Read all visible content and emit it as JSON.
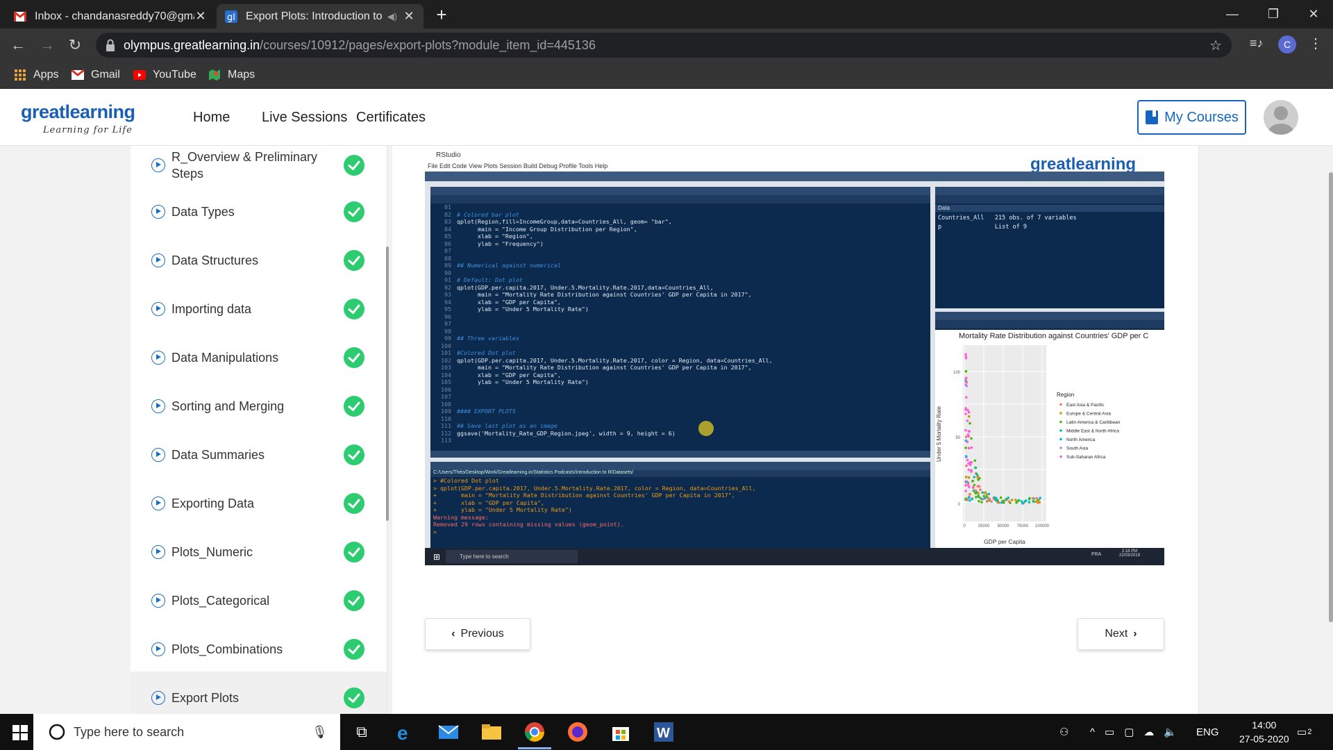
{
  "browser": {
    "tabs": [
      {
        "title": "Inbox - chandanasreddy70@gma",
        "icon": "gmail-icon"
      },
      {
        "title": "Export Plots: Introduction to",
        "icon": "greatlearning-icon",
        "active": true
      }
    ],
    "url_domain": "olympus.greatlearning.in",
    "url_path": "/courses/10912/pages/export-plots?module_item_id=445136",
    "profile_initial": "C",
    "bookmarks": [
      {
        "label": "Apps",
        "icon": "apps-grid-icon"
      },
      {
        "label": "Gmail",
        "icon": "gmail-icon"
      },
      {
        "label": "YouTube",
        "icon": "youtube-icon"
      },
      {
        "label": "Maps",
        "icon": "maps-icon"
      }
    ]
  },
  "site": {
    "logo": "greatlearning",
    "logo_tagline": "Learning for Life",
    "nav": [
      "Home",
      "Live Sessions",
      "Certificates"
    ],
    "my_courses": "My Courses"
  },
  "sidebar": {
    "modules": [
      {
        "label": "R_Overview & Preliminary Steps",
        "completed": true
      },
      {
        "label": "Data Types",
        "completed": true
      },
      {
        "label": "Data Structures",
        "completed": true
      },
      {
        "label": "Importing data",
        "completed": true
      },
      {
        "label": "Data Manipulations",
        "completed": true
      },
      {
        "label": "Sorting and Merging",
        "completed": true
      },
      {
        "label": "Data Summaries",
        "completed": true
      },
      {
        "label": "Exporting Data",
        "completed": true
      },
      {
        "label": "Plots_Numeric",
        "completed": true
      },
      {
        "label": "Plots_Categorical",
        "completed": true
      },
      {
        "label": "Plots_Combinations",
        "completed": true
      },
      {
        "label": "Export Plots",
        "completed": true,
        "active": true
      }
    ]
  },
  "video": {
    "window_title": "RStudio",
    "menu": "File   Edit   Code   View   Plots   Session   Build   Debug   Profile   Tools   Help",
    "watermark": "greatlearning",
    "code_lines": [
      {
        "n": "81",
        "t": ""
      },
      {
        "n": "82",
        "t": "# Colored bar plot",
        "cls": "c"
      },
      {
        "n": "83",
        "t": "qplot(Region,fill=IncomeGroup,data=Countries_All, geom= \"bar\","
      },
      {
        "n": "84",
        "t": "      main = \"Income Group Distribution per Region\","
      },
      {
        "n": "85",
        "t": "      xlab = \"Region\","
      },
      {
        "n": "86",
        "t": "      ylab = \"Frequency\")"
      },
      {
        "n": "87",
        "t": ""
      },
      {
        "n": "88",
        "t": ""
      },
      {
        "n": "89",
        "t": "## Numerical against numerical",
        "cls": "c"
      },
      {
        "n": "90",
        "t": ""
      },
      {
        "n": "91",
        "t": "# Default: Dot plot",
        "cls": "c"
      },
      {
        "n": "92",
        "t": "qplot(GDP.per.capita.2017, Under.5.Mortality.Rate.2017,data=Countries_All,"
      },
      {
        "n": "93",
        "t": "      main = \"Mortality Rate Distribution against Countries' GDP per Capita in 2017\","
      },
      {
        "n": "94",
        "t": "      xlab = \"GDP per Capita\","
      },
      {
        "n": "95",
        "t": "      ylab = \"Under 5 Mortality Rate\")"
      },
      {
        "n": "96",
        "t": ""
      },
      {
        "n": "97",
        "t": ""
      },
      {
        "n": "98",
        "t": ""
      },
      {
        "n": "99",
        "t": "## Three variables",
        "cls": "c"
      },
      {
        "n": "100",
        "t": ""
      },
      {
        "n": "101",
        "t": "#Colored Dot plot",
        "cls": "c"
      },
      {
        "n": "102",
        "t": "qplot(GDP.per.capita.2017, Under.5.Mortality.Rate.2017, color = Region, data=Countries_All,"
      },
      {
        "n": "103",
        "t": "      main = \"Mortality Rate Distribution against Countries' GDP per Capita in 2017\","
      },
      {
        "n": "104",
        "t": "      xlab = \"GDP per Capita\","
      },
      {
        "n": "105",
        "t": "      ylab = \"Under 5 Mortality Rate\")"
      },
      {
        "n": "106",
        "t": ""
      },
      {
        "n": "107",
        "t": ""
      },
      {
        "n": "108",
        "t": ""
      },
      {
        "n": "109",
        "t": "#### EXPORT PLOTS",
        "cls": "c"
      },
      {
        "n": "110",
        "t": ""
      },
      {
        "n": "111",
        "t": "## Save last plot as an image",
        "cls": "c"
      },
      {
        "n": "112",
        "t": "ggsave('Mortality_Rate_GDP_Region.jpeg', width = 9, height = 6)"
      },
      {
        "n": "113",
        "t": ""
      }
    ],
    "console_path": "C:/Users/Théo/Desktop/Work/Greatlearning.in/Statistics Podcasts/Introduction to R/Datasets/",
    "console_lines": [
      {
        "t": "> #Colored Dot plot"
      },
      {
        "t": "> qplot(GDP.per.capita.2017, Under.5.Mortality.Rate.2017, color = Region, data=Countries_All,"
      },
      {
        "t": "+       main = \"Mortality Rate Distribution against Countries' GDP per Capita in 2017\","
      },
      {
        "t": "+       xlab = \"GDP per Capita\","
      },
      {
        "t": "+       ylab = \"Under 5 Mortality Rate\")"
      },
      {
        "t": "Warning message:",
        "cls": "r"
      },
      {
        "t": "Removed 29 rows containing missing values (geom_point).",
        "cls": "r"
      },
      {
        "t": "> "
      }
    ],
    "env_header": "Data",
    "env_rows": [
      {
        "t": "Countries_All   215 obs. of 7 variables"
      },
      {
        "t": "p               List of 9"
      }
    ],
    "plot_title": "Mortality Rate Distribution against Countries' GDP per C",
    "plot_ylabel": "Under 5 Mortality Rate",
    "plot_xlabel": "GDP per Capita",
    "plot_yticks": [
      "100",
      "50",
      "0"
    ],
    "plot_xticks": [
      "0",
      "25000",
      "50000",
      "75000",
      "100000"
    ],
    "legend_title": "Region",
    "legend": [
      {
        "name": "East Asia & Pacific",
        "color": "#f8766d"
      },
      {
        "name": "Europe & Central Asia",
        "color": "#c49a00"
      },
      {
        "name": "Latin America & Caribbean",
        "color": "#53b400"
      },
      {
        "name": "Middle East & North Africa",
        "color": "#00c094"
      },
      {
        "name": "North America",
        "color": "#00b6eb"
      },
      {
        "name": "South Asia",
        "color": "#a58aff"
      },
      {
        "name": "Sub-Saharan Africa",
        "color": "#fb61d7"
      }
    ],
    "inner_search": "Type here to search",
    "inner_time": "2:18 PM",
    "inner_date": "22/03/2019",
    "inner_lang": "FRA"
  },
  "pager": {
    "previous": "Previous",
    "next": "Next"
  },
  "taskbar": {
    "search_placeholder": "Type here to search",
    "lang": "ENG",
    "time": "14:00",
    "date": "27-05-2020",
    "notifications": "2"
  }
}
